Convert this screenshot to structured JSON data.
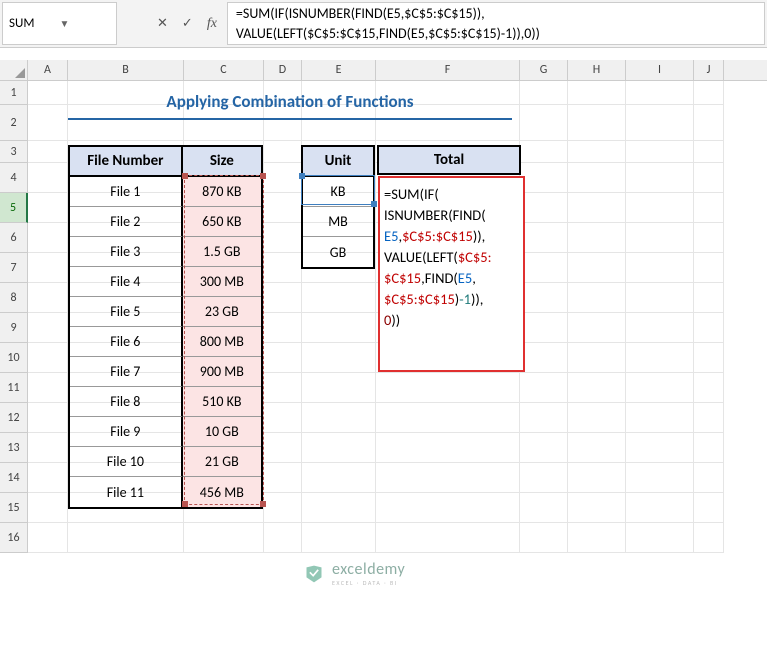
{
  "name_box": "SUM",
  "formula_bar": "=SUM(IF(ISNUMBER(FIND(E5,$C$5:$C$15)), VALUE(LEFT($C$5:$C$15,FIND(E5,$C$5:$C$15)-1)),0))",
  "title": "Applying Combination of Functions",
  "col_labels": [
    "A",
    "B",
    "C",
    "D",
    "E",
    "F",
    "G",
    "H",
    "I",
    "J"
  ],
  "row_labels": [
    "1",
    "2",
    "3",
    "4",
    "5",
    "6",
    "7",
    "8",
    "9",
    "10",
    "11",
    "12",
    "13",
    "14",
    "15",
    "16"
  ],
  "active_row": "5",
  "table1": {
    "headers": [
      "File Number",
      "Size"
    ],
    "rows": [
      [
        "File 1",
        "870 KB"
      ],
      [
        "File 2",
        "650 KB"
      ],
      [
        "File 3",
        "1.5 GB"
      ],
      [
        "File 4",
        "300 MB"
      ],
      [
        "File 5",
        "23 GB"
      ],
      [
        "File 6",
        "800 MB"
      ],
      [
        "File 7",
        "900 MB"
      ],
      [
        "File 8",
        "510 KB"
      ],
      [
        "File 9",
        "10 GB"
      ],
      [
        "File 10",
        "21 GB"
      ],
      [
        "File 11",
        "456 MB"
      ]
    ]
  },
  "table2": {
    "header": "Unit",
    "rows": [
      "KB",
      "MB",
      "GB"
    ]
  },
  "total_header": "Total",
  "formula_overlay": {
    "p1a": "=SUM(",
    "p1b": "IF",
    "p1c": "(",
    "p2a": "ISNUMBER",
    "p2b": "(",
    "p2c": "FIND",
    "p2d": "(",
    "p3a": "E5",
    "p3b": ",",
    "p3c": "$C$5:$C$15",
    "p3d": ")),",
    "p4a": "VALUE",
    "p4b": "(",
    "p4c": "LEFT",
    "p4d": "(",
    "p4e": "$C$5:",
    "p5a": "$C$15",
    "p5b": ",",
    "p5c": "FIND",
    "p5d": "(",
    "p5e": "E5",
    "p5f": ",",
    "p6a": "$C$5:$C$15",
    "p6b": ")",
    "p6c": "-1",
    "p6d": ")),",
    "p7a": "0",
    "p7b": "))"
  },
  "watermark": {
    "main": "exceldemy",
    "sub": "EXCEL · DATA · BI"
  }
}
